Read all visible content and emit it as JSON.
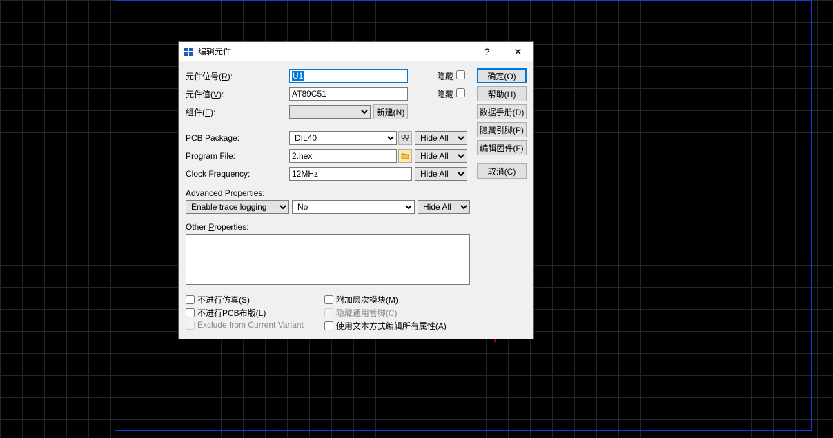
{
  "dialog": {
    "title": "编辑元件",
    "help_btn": "?",
    "close_btn": "✕"
  },
  "labels": {
    "ref": "元件位号",
    "ref_key": "R",
    "value": "元件值",
    "value_key": "V",
    "element": "组件",
    "element_key": "E",
    "new_btn": "新建(N)",
    "hidden": "隐藏",
    "pcb_package": "PCB Package:",
    "program_file": "Program File:",
    "clock_freq": "Clock Frequency:",
    "advanced": "Advanced Properties:",
    "other_props_pre": "Other ",
    "other_props_u": "P",
    "other_props_post": "roperties:"
  },
  "fields": {
    "ref": "U1",
    "value": "AT89C51",
    "element": "",
    "pcb_package": "DIL40",
    "program_file": "2.hex",
    "clock_freq": "12MHz",
    "adv_prop": "Enable trace logging",
    "adv_val": "No",
    "other": ""
  },
  "visibility": {
    "hide_all": "Hide All"
  },
  "buttons": {
    "ok": "确定(O)",
    "help": "帮助(H)",
    "datasheet": "数据手册(D)",
    "hidden_pins": "隐藏引脚(P)",
    "edit_firmware": "编辑固件(F)",
    "cancel": "取消(C)"
  },
  "checks": {
    "no_sim": "不进行仿真(S)",
    "no_pcb": "不进行PCB布版(L)",
    "exclude_variant": "Exclude from Current Variant",
    "attach_hier": "附加层次模块(M)",
    "hide_common_pins": "隐藏通用管脚(C)",
    "edit_as_text": "使用文本方式编辑所有属性(A)"
  }
}
